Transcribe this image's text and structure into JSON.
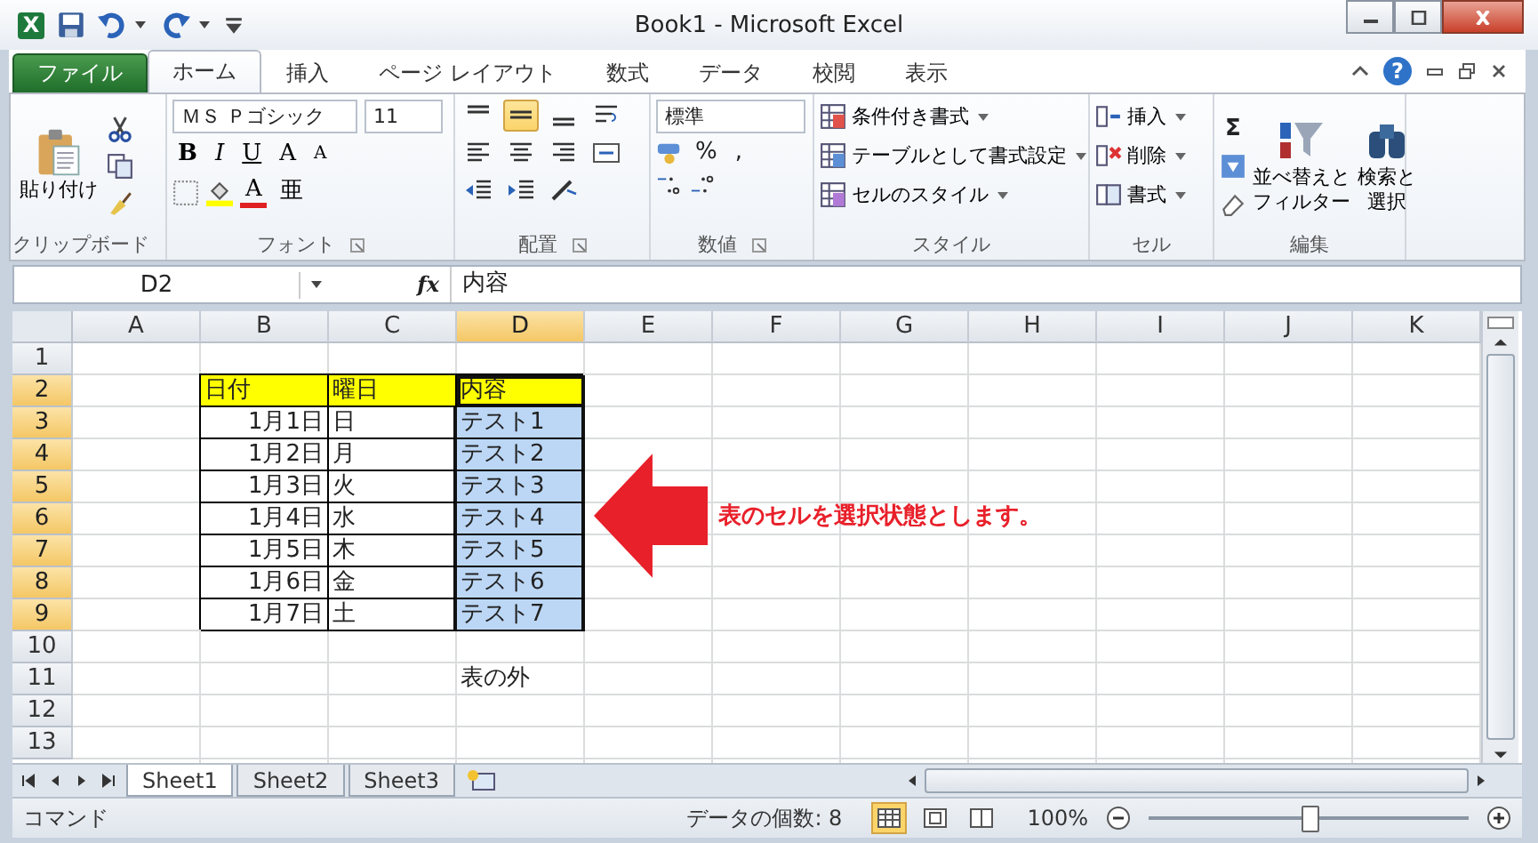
{
  "window": {
    "logo": "X",
    "title": "Book1 - Microsoft Excel"
  },
  "tabs": [
    {
      "label": "ファイル",
      "kind": "file",
      "selected": false
    },
    {
      "label": "ホーム",
      "kind": "tab",
      "selected": true
    },
    {
      "label": "挿入",
      "kind": "tab",
      "selected": false
    },
    {
      "label": "ページ レイアウト",
      "kind": "tab",
      "selected": false
    },
    {
      "label": "数式",
      "kind": "tab",
      "selected": false
    },
    {
      "label": "データ",
      "kind": "tab",
      "selected": false
    },
    {
      "label": "校閲",
      "kind": "tab",
      "selected": false
    },
    {
      "label": "表示",
      "kind": "tab",
      "selected": false
    }
  ],
  "help": "?",
  "ribbon": {
    "clipboard": {
      "label": "クリップボード",
      "paste": "貼り付け"
    },
    "font": {
      "label": "フォント",
      "font_name": "ＭＳ Ｐゴシック",
      "font_size": "11",
      "format_buttons": [
        "B",
        "I",
        "U"
      ],
      "size_buttons": [
        "A",
        "A"
      ],
      "color_button": "A",
      "phonetic": "亜"
    },
    "alignment": {
      "label": "配置",
      "vertical": [
        {
          "selected": false
        },
        {
          "selected": true
        },
        {
          "selected": false
        }
      ]
    },
    "number": {
      "label": "数値",
      "format": "標準",
      "percent": "%",
      "comma": ","
    },
    "styles": {
      "label": "スタイル",
      "items": [
        "条件付き書式",
        "テーブルとして書式設定",
        "セルのスタイル"
      ]
    },
    "cells": {
      "label": "セル",
      "items": [
        "挿入",
        "削除",
        "書式"
      ]
    },
    "editing": {
      "label": "編集",
      "sum": "Σ",
      "sort": "並べ替えとフィルター",
      "find": "検索と選択"
    }
  },
  "formula_bar": {
    "name_box": "D2",
    "fx": "fx",
    "formula": "内容"
  },
  "sheet": {
    "columns": [
      {
        "label": "A",
        "selected": false
      },
      {
        "label": "B",
        "selected": false
      },
      {
        "label": "C",
        "selected": false
      },
      {
        "label": "D",
        "selected": true
      },
      {
        "label": "E",
        "selected": false
      },
      {
        "label": "F",
        "selected": false
      },
      {
        "label": "G",
        "selected": false
      },
      {
        "label": "H",
        "selected": false
      },
      {
        "label": "I",
        "selected": false
      },
      {
        "label": "J",
        "selected": false
      },
      {
        "label": "K",
        "selected": false
      }
    ],
    "rows": [
      {
        "label": "1",
        "selected": false
      },
      {
        "label": "2",
        "selected": true
      },
      {
        "label": "3",
        "selected": true
      },
      {
        "label": "4",
        "selected": true
      },
      {
        "label": "5",
        "selected": true
      },
      {
        "label": "6",
        "selected": true
      },
      {
        "label": "7",
        "selected": true
      },
      {
        "label": "8",
        "selected": true
      },
      {
        "label": "9",
        "selected": true
      },
      {
        "label": "10",
        "selected": false
      },
      {
        "label": "11",
        "selected": false
      },
      {
        "label": "12",
        "selected": false
      },
      {
        "label": "13",
        "selected": false
      }
    ],
    "table": {
      "header": [
        {
          "text": "日付",
          "active": false
        },
        {
          "text": "曜日",
          "active": false
        },
        {
          "text": "内容",
          "active": true
        }
      ],
      "rows": [
        {
          "cells": [
            {
              "text": "1月1日",
              "kind": "date",
              "selected": false
            },
            {
              "text": "日",
              "kind": "text",
              "selected": false
            },
            {
              "text": "テスト1",
              "kind": "text",
              "selected": true
            }
          ]
        },
        {
          "cells": [
            {
              "text": "1月2日",
              "kind": "date",
              "selected": false
            },
            {
              "text": "月",
              "kind": "text",
              "selected": false
            },
            {
              "text": "テスト2",
              "kind": "text",
              "selected": true
            }
          ]
        },
        {
          "cells": [
            {
              "text": "1月3日",
              "kind": "date",
              "selected": false
            },
            {
              "text": "火",
              "kind": "text",
              "selected": false
            },
            {
              "text": "テスト3",
              "kind": "text",
              "selected": true
            }
          ]
        },
        {
          "cells": [
            {
              "text": "1月4日",
              "kind": "date",
              "selected": false
            },
            {
              "text": "水",
              "kind": "text",
              "selected": false
            },
            {
              "text": "テスト4",
              "kind": "text",
              "selected": true
            }
          ]
        },
        {
          "cells": [
            {
              "text": "1月5日",
              "kind": "date",
              "selected": false
            },
            {
              "text": "木",
              "kind": "text",
              "selected": false
            },
            {
              "text": "テスト5",
              "kind": "text",
              "selected": true
            }
          ]
        },
        {
          "cells": [
            {
              "text": "1月6日",
              "kind": "date",
              "selected": false
            },
            {
              "text": "金",
              "kind": "text",
              "selected": false
            },
            {
              "text": "テスト6",
              "kind": "text",
              "selected": true
            }
          ]
        },
        {
          "cells": [
            {
              "text": "1月7日",
              "kind": "date",
              "selected": false
            },
            {
              "text": "土",
              "kind": "text",
              "selected": false
            },
            {
              "text": "テスト7",
              "kind": "text",
              "selected": true
            }
          ]
        }
      ]
    },
    "note": {
      "text": "表の外"
    },
    "annotation": {
      "text": "表のセルを選択状態とします。"
    }
  },
  "sheet_tabs": [
    {
      "label": "Sheet1",
      "selected": true
    },
    {
      "label": "Sheet2",
      "selected": false
    },
    {
      "label": "Sheet3",
      "selected": false
    }
  ],
  "status_bar": {
    "mode": "コマンド",
    "count": "データの個数: 8",
    "views": [
      {
        "selected": true
      },
      {
        "selected": false
      },
      {
        "selected": false
      }
    ],
    "zoom": "100%",
    "zoom_slider": {
      "level": 0.5
    }
  }
}
